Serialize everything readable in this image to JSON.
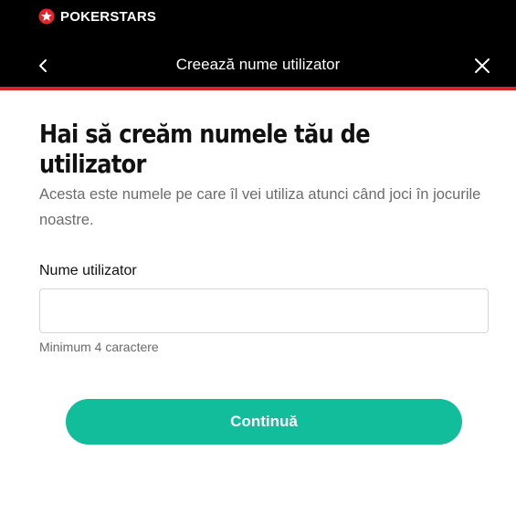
{
  "brand": {
    "name": "POKERSTARS"
  },
  "header": {
    "title": "Creează nume utilizator"
  },
  "main": {
    "heading": "Hai să creăm numele tău de utilizator",
    "subtitle": "Acesta este numele pe care îl vei utiliza atunci când joci în jocurile noastre."
  },
  "form": {
    "username_label": "Nume utilizator",
    "username_value": "",
    "username_placeholder": "",
    "hint": "Minimum 4 caractere",
    "continue_label": "Continuă"
  },
  "icons": {
    "back": "chevron-left-icon",
    "close": "close-icon",
    "logo": "star-logo-icon"
  },
  "colors": {
    "header_bg": "#000000",
    "accent_red": "#d6262b",
    "button": "#12bd9c"
  }
}
